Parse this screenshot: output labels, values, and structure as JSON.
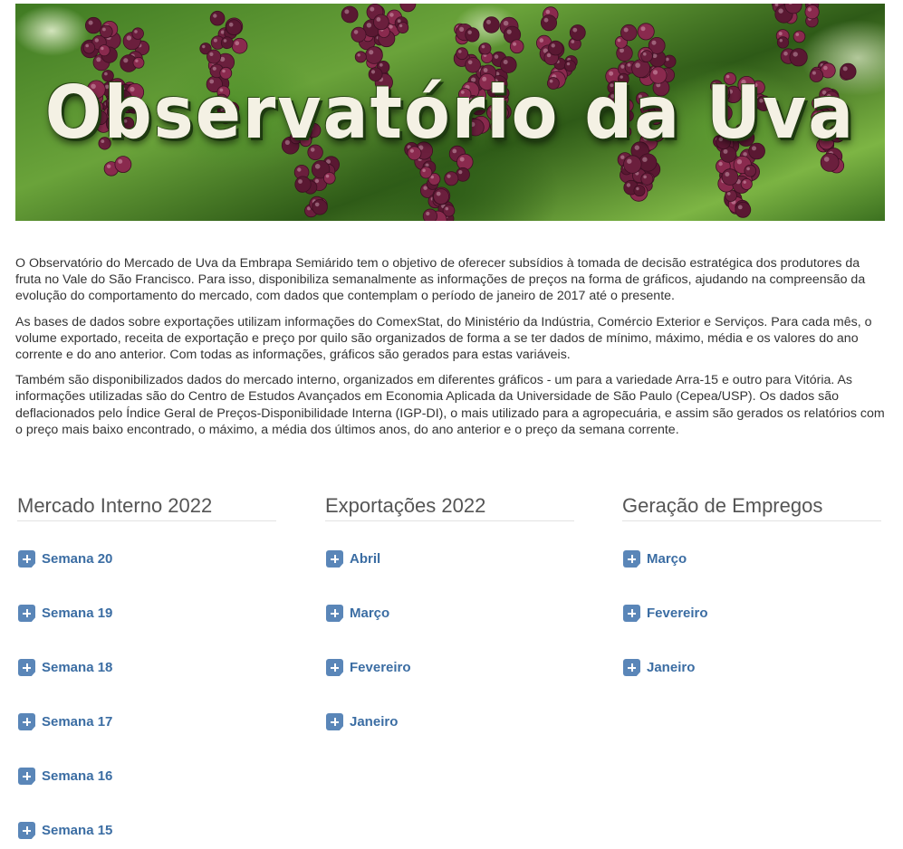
{
  "banner": {
    "title": "Observatório da Uva"
  },
  "intro": {
    "paragraphs": [
      "O Observatório do Mercado de Uva da Embrapa Semiárido tem o objetivo de oferecer subsídios à tomada de decisão estratégica dos produtores da fruta no Vale do São Francisco. Para isso, disponibiliza semanalmente as informações de preços na forma de gráficos, ajudando na compreensão da evolução do comportamento do mercado, com dados que contemplam o período de janeiro de 2017 até o presente.",
      "As bases de dados sobre exportações utilizam informações do ComexStat, do Ministério da Indústria, Comércio Exterior e Serviços. Para cada mês, o volume exportado, receita de exportação e preço por quilo são organizados de forma a se ter dados de mínimo, máximo, média e os valores do ano corrente e do ano anterior. Com todas as informações, gráficos são gerados para estas variáveis.",
      "Também são disponibilizados dados do mercado interno, organizados em diferentes gráficos - um para a variedade Arra-15 e outro para Vitória.  As informações utilizadas são do Centro de Estudos Avançados em Economia Aplicada da Universidade de São Paulo (Cepea/USP). Os dados são deflacionados pelo Índice Geral de Preços-Disponibilidade Interna (IGP-DI), o mais utilizado para a agropecuária, e assim são gerados os relatórios com o preço mais baixo encontrado, o máximo, a média dos últimos anos, do ano anterior e o preço da semana corrente."
    ]
  },
  "columns": {
    "mercado": {
      "title": "Mercado Interno 2022",
      "items": [
        "Semana 20",
        "Semana 19",
        "Semana 18",
        "Semana 17",
        "Semana 16",
        "Semana 15"
      ]
    },
    "exportacoes": {
      "title": "Exportações 2022",
      "items": [
        "Abril",
        "Março",
        "Fevereiro",
        "Janeiro"
      ]
    },
    "empregos": {
      "title": "Geração de Empregos",
      "items": [
        "Março",
        "Fevereiro",
        "Janeiro"
      ]
    }
  },
  "icons": {
    "expand": "plus-icon"
  },
  "colors": {
    "link": "#3b6da3",
    "icon": "#5a86b8",
    "heading": "#555555",
    "text": "#333333"
  }
}
